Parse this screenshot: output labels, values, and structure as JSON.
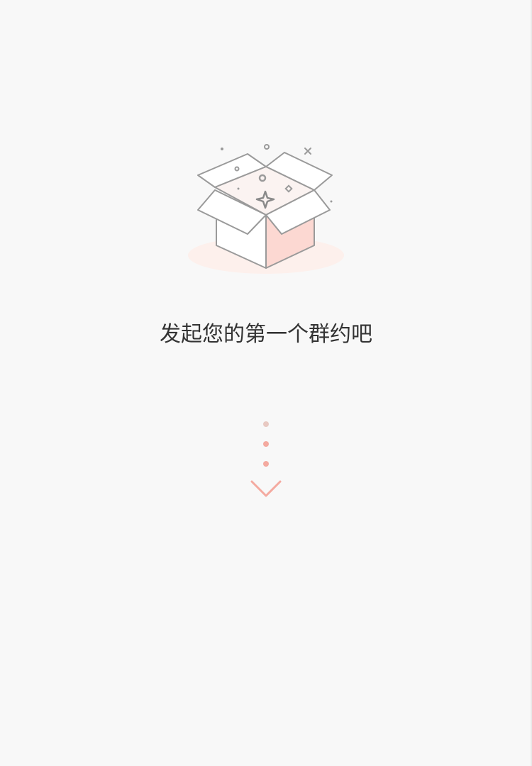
{
  "empty_state": {
    "message": "发起您的第一个群约吧",
    "illustration_icon": "open-box-icon"
  },
  "scroll_hint": {
    "icon": "chevron-down-icon"
  },
  "colors": {
    "background": "#f8f8f8",
    "text": "#333333",
    "box_outline": "#9a9a9a",
    "box_accent": "#fcd8d2",
    "box_shadow": "#fdf0ec",
    "dot_light": "#e8c9c2",
    "dot_accent": "#f4aaa0",
    "chevron": "#f4aaa0"
  }
}
